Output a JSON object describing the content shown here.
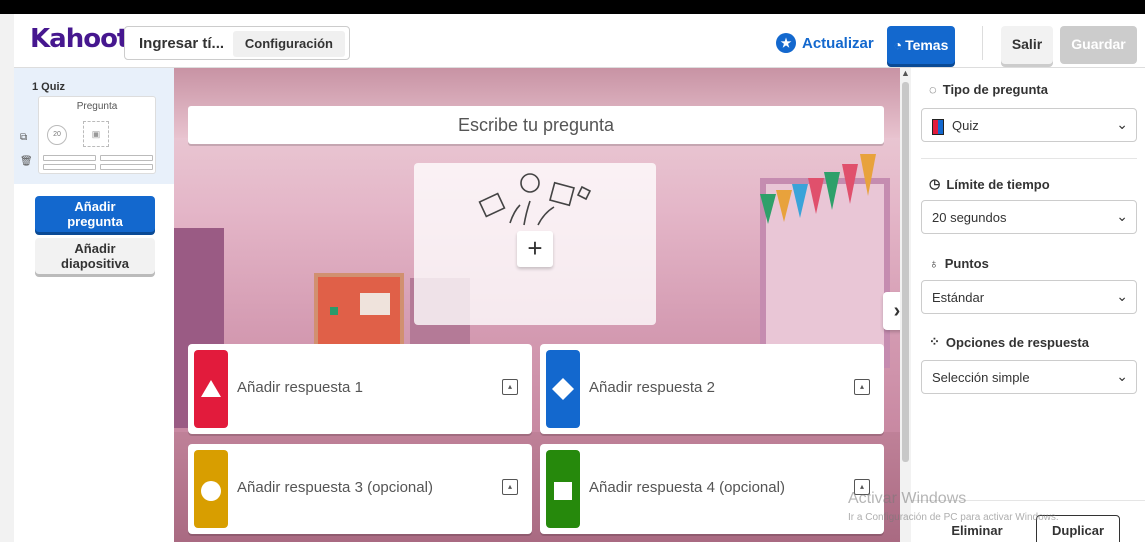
{
  "header": {
    "logo": "Kahoot!",
    "title_input": "Ingresar tí...",
    "settings_label": "Configuración",
    "update_label": "Actualizar",
    "themes_label": "Temas",
    "exit_label": "Salir",
    "save_label": "Guardar"
  },
  "sidebar": {
    "slide_label": "1 Quiz",
    "thumb_question": "Pregunta",
    "thumb_timer": "20",
    "add_question_line1": "Añadir",
    "add_question_line2": "pregunta",
    "add_slide_line1": "Añadir",
    "add_slide_line2": "diapositiva"
  },
  "editor": {
    "question_placeholder": "Escribe tu pregunta",
    "answers": [
      {
        "label": "Añadir respuesta 1",
        "color": "#e21b3c",
        "shape": "triangle"
      },
      {
        "label": "Añadir respuesta 2",
        "color": "#1368ce",
        "shape": "diamond"
      },
      {
        "label": "Añadir respuesta 3 (opcional)",
        "color": "#d89e00",
        "shape": "circle"
      },
      {
        "label": "Añadir respuesta 4 (opcional)",
        "color": "#26890c",
        "shape": "square"
      }
    ]
  },
  "settings": {
    "question_type_title": "Tipo de pregunta",
    "question_type_value": "Quiz",
    "time_limit_title": "Límite de tiempo",
    "time_limit_value": "20 segundos",
    "points_title": "Puntos",
    "points_value": "Estándar",
    "answer_options_title": "Opciones de respuesta",
    "answer_options_value": "Selección simple",
    "delete_label": "Eliminar",
    "duplicate_label": "Duplicar"
  },
  "watermark": {
    "line1": "Activar Windows",
    "line2": "Ir a Configuración de PC para activar Windows."
  }
}
